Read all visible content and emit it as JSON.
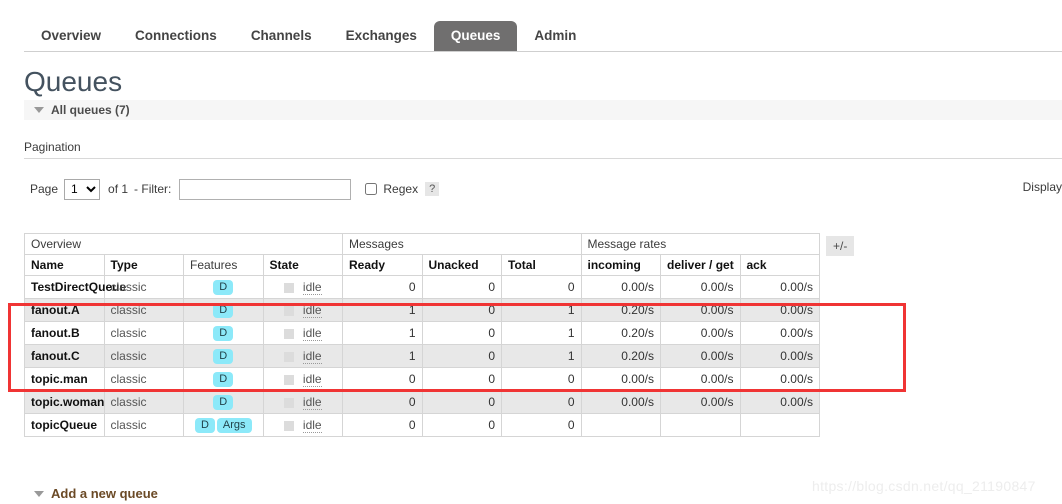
{
  "nav": {
    "tabs": [
      {
        "label": "Overview",
        "selected": false
      },
      {
        "label": "Connections",
        "selected": false
      },
      {
        "label": "Channels",
        "selected": false
      },
      {
        "label": "Exchanges",
        "selected": false
      },
      {
        "label": "Queues",
        "selected": true
      },
      {
        "label": "Admin",
        "selected": false
      }
    ]
  },
  "page": {
    "title": "Queues",
    "all_queues_label": "All queues (7)",
    "pagination_section_label": "Pagination",
    "display_label": "Display"
  },
  "pagination": {
    "page_word": "Page",
    "page_value": "1",
    "page_options": [
      "1"
    ],
    "of_text": "of 1",
    "filter_label": "- Filter:",
    "filter_value": "",
    "filter_placeholder": "",
    "regex_label": "Regex",
    "regex_checked": false,
    "help_label": "?"
  },
  "table": {
    "group_headers": [
      {
        "label": "Overview",
        "span": 4
      },
      {
        "label": "Messages",
        "span": 3
      },
      {
        "label": "Message rates",
        "span": 3
      }
    ],
    "columns": [
      {
        "label": "Name",
        "bold": true,
        "align": "left"
      },
      {
        "label": "Type",
        "bold": true,
        "align": "left"
      },
      {
        "label": "Features",
        "bold": false,
        "align": "left"
      },
      {
        "label": "State",
        "bold": true,
        "align": "left"
      },
      {
        "label": "Ready",
        "bold": true,
        "align": "right"
      },
      {
        "label": "Unacked",
        "bold": true,
        "align": "right"
      },
      {
        "label": "Total",
        "bold": true,
        "align": "right"
      },
      {
        "label": "incoming",
        "bold": true,
        "align": "right"
      },
      {
        "label": "deliver / get",
        "bold": true,
        "align": "right"
      },
      {
        "label": "ack",
        "bold": true,
        "align": "right"
      }
    ],
    "toggle_columns_label": "+/-",
    "rows": [
      {
        "name": "TestDirectQueue",
        "type": "classic",
        "features": [
          "D"
        ],
        "state": "idle",
        "ready": "0",
        "unacked": "0",
        "total": "0",
        "incoming": "0.00/s",
        "deliver_get": "0.00/s",
        "ack": "0.00/s"
      },
      {
        "name": "fanout.A",
        "type": "classic",
        "features": [
          "D"
        ],
        "state": "idle",
        "ready": "1",
        "unacked": "0",
        "total": "1",
        "incoming": "0.20/s",
        "deliver_get": "0.00/s",
        "ack": "0.00/s"
      },
      {
        "name": "fanout.B",
        "type": "classic",
        "features": [
          "D"
        ],
        "state": "idle",
        "ready": "1",
        "unacked": "0",
        "total": "1",
        "incoming": "0.20/s",
        "deliver_get": "0.00/s",
        "ack": "0.00/s"
      },
      {
        "name": "fanout.C",
        "type": "classic",
        "features": [
          "D"
        ],
        "state": "idle",
        "ready": "1",
        "unacked": "0",
        "total": "1",
        "incoming": "0.20/s",
        "deliver_get": "0.00/s",
        "ack": "0.00/s"
      },
      {
        "name": "topic.man",
        "type": "classic",
        "features": [
          "D"
        ],
        "state": "idle",
        "ready": "0",
        "unacked": "0",
        "total": "0",
        "incoming": "0.00/s",
        "deliver_get": "0.00/s",
        "ack": "0.00/s"
      },
      {
        "name": "topic.woman",
        "type": "classic",
        "features": [
          "D"
        ],
        "state": "idle",
        "ready": "0",
        "unacked": "0",
        "total": "0",
        "incoming": "0.00/s",
        "deliver_get": "0.00/s",
        "ack": "0.00/s"
      },
      {
        "name": "topicQueue",
        "type": "classic",
        "features": [
          "D",
          "Args"
        ],
        "state": "idle",
        "ready": "0",
        "unacked": "0",
        "total": "0",
        "incoming": "",
        "deliver_get": "",
        "ack": ""
      }
    ]
  },
  "footer": {
    "add_queue_label": "Add a new queue",
    "watermark": "https://blog.csdn.net/qq_21190847"
  },
  "colors": {
    "selected_tab_bg": "#706f6f",
    "badge_bg": "#8ce9f9",
    "annotation": "#f03434",
    "heading": "#44525f",
    "row_alt_bg": "#e8e8e8"
  }
}
